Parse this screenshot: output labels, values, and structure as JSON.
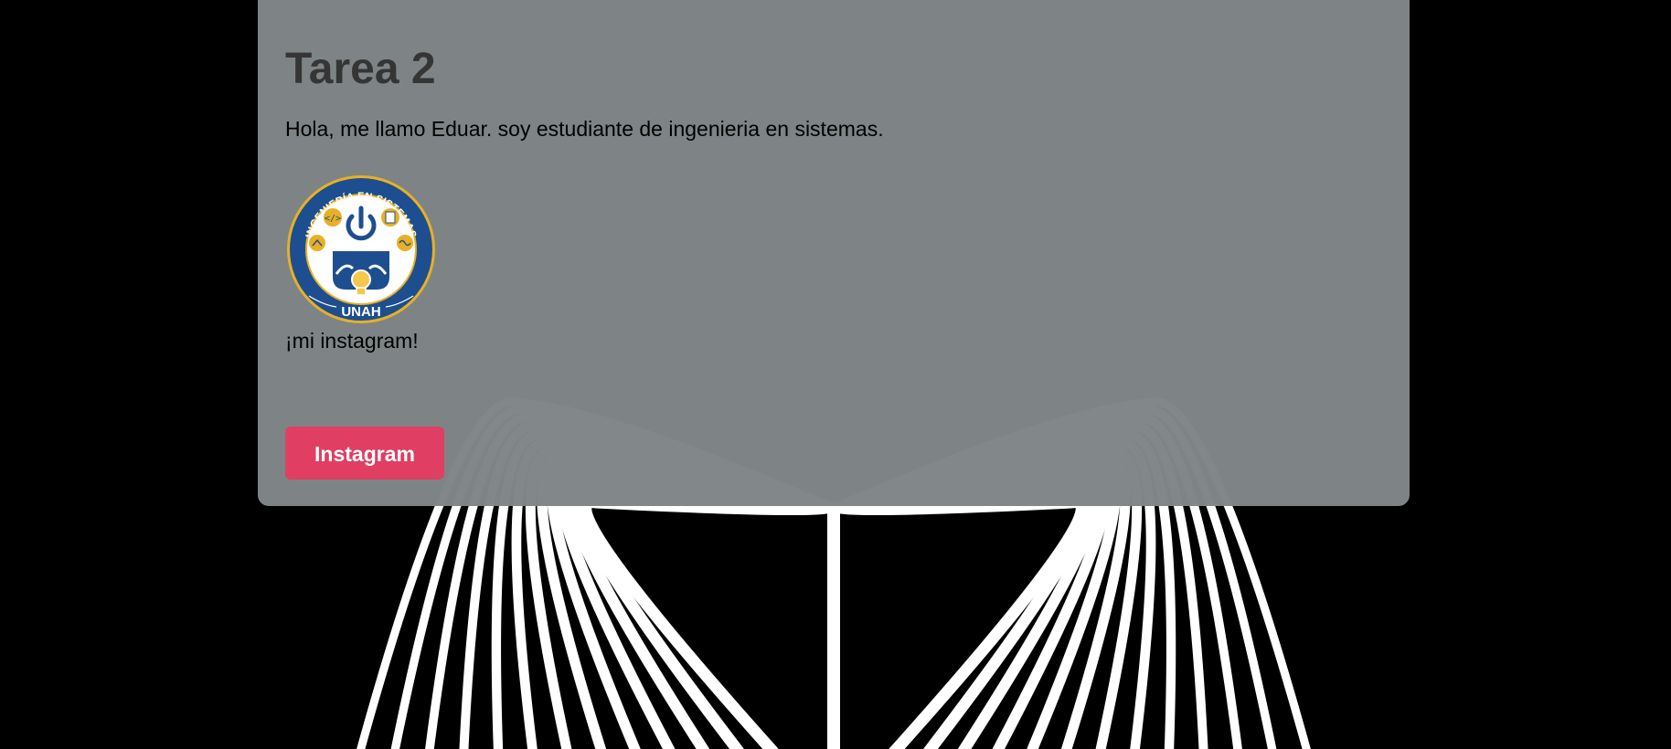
{
  "page": {
    "title": "Tarea 2",
    "intro": "Hola, me llamo Eduar. soy estudiante de ingenieria en sistemas.",
    "cta_text": "¡mi instagram!",
    "button_label": "Instagram"
  },
  "logo": {
    "top_text": "INGENIERÍA EN SISTEMAS",
    "bottom_text": "UNAH",
    "icon": "unah-systems-engineering-seal"
  },
  "background": {
    "icon": "white-stripe-wave-pattern"
  },
  "colors": {
    "page_background": "#000000",
    "card_background": "#808687",
    "title": "#353535",
    "button": "#e03e63",
    "button_text": "#ffffff",
    "seal_blue": "#1d4e8f",
    "seal_gold": "#e8b025"
  }
}
